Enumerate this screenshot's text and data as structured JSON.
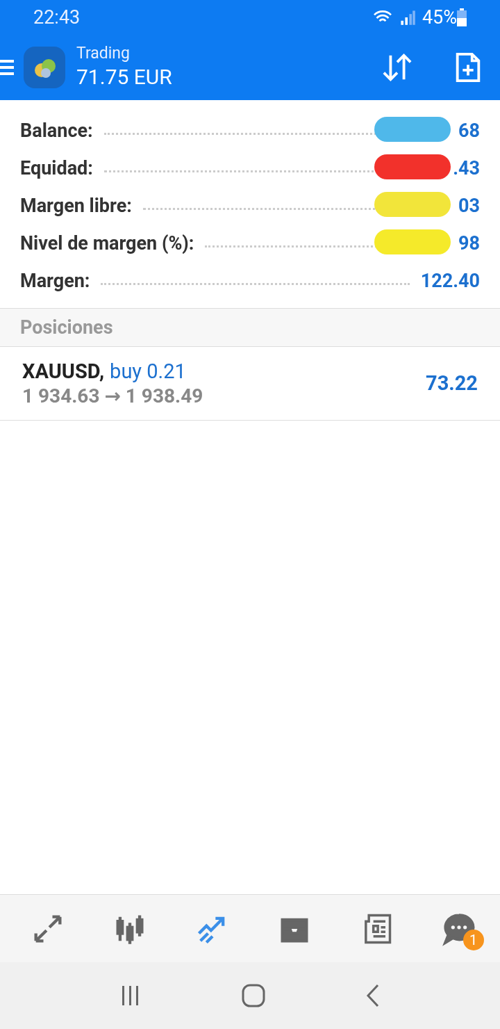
{
  "status_bar": {
    "time": "22:43",
    "battery": "45%"
  },
  "header": {
    "title": "Trading",
    "balance": "71.75 EUR"
  },
  "account": [
    {
      "label": "Balance:",
      "value": "68",
      "color": "#4fb8ea"
    },
    {
      "label": "Equidad:",
      "value": ".43",
      "color": "#f2312b"
    },
    {
      "label": "Margen libre:",
      "value": "03",
      "color": "#f2e53a"
    },
    {
      "label": "Nivel de margen (%):",
      "value": "98",
      "color": "#f5ea2a"
    },
    {
      "label": "Margen:",
      "value": "122.40"
    }
  ],
  "section": "Posiciones",
  "positions": [
    {
      "symbol": "XAUUSD,",
      "side": "buy 0.21",
      "prices": "1 934.63 → 1 938.49",
      "profit": "73.22"
    }
  ],
  "nav": [
    {
      "kind": "quotes",
      "selected": false
    },
    {
      "kind": "chart",
      "selected": false
    },
    {
      "kind": "trade",
      "selected": true
    },
    {
      "kind": "history",
      "selected": false
    },
    {
      "kind": "news",
      "selected": false
    },
    {
      "kind": "chat",
      "selected": false,
      "badge": "1"
    }
  ]
}
